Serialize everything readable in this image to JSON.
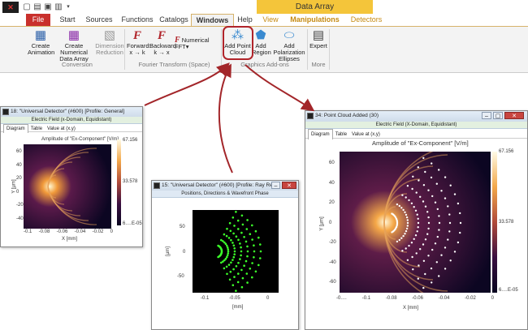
{
  "app": {
    "title": "Data Array"
  },
  "qat": [
    "new-icon",
    "open-icon",
    "save-icon",
    "print-icon",
    "dropdown-icon"
  ],
  "tabs": {
    "file": "File",
    "start": "Start",
    "sources": "Sources",
    "functions": "Functions",
    "catalogs": "Catalogs",
    "windows": "Windows",
    "help": "Help",
    "view": "View",
    "manipulations": "Manipulations",
    "detectors": "Detectors"
  },
  "ribbon": {
    "create_animation": "Create\nAnimation",
    "create_numerical": "Create Numerical\nData Array",
    "dimension_reduction": "Dimension\nReduction",
    "group_conversion": "Conversion",
    "forward": "Forward:\nx → k",
    "backward": "Backward:\nk → x",
    "numerical_fft": "Numerical FFT",
    "group_fourier": "Fourier Transform (Space)",
    "add_point_cloud": "Add Point\nCloud",
    "add_region": "Add\nRegion",
    "add_polarization": "Add Polarization\nEllipses",
    "group_graphics": "Graphics Add-ons",
    "expert": "Expert",
    "group_more": "More"
  },
  "win_left": {
    "title": "18: \"Universal Detector\" (#600) [Profile: General]",
    "subtitle": "Electric Field (x-Domain, Equidistant)",
    "tabs": [
      "Diagram",
      "Table",
      "Value at (x,y)"
    ],
    "plot_title": "Amplitude of \"Ex-Component\" [V/m]",
    "xticks": [
      "-0.1",
      "-0.08",
      "-0.06",
      "-0.04",
      "-0.02",
      "0"
    ],
    "yticks": [
      "60",
      "40",
      "20",
      "0",
      "-20",
      "-40",
      "-60"
    ],
    "xlabel": "X [mm]",
    "ylabel": "Y [µm]",
    "cbar": [
      "67.156",
      "33.578",
      "6.…E-05"
    ]
  },
  "win_mid": {
    "title": "15: \"Universal Detector\" (#600) [Profile: Ray Re…",
    "subtitle": "Positions, Directions & Wavefront Phase",
    "yticks": [
      "50",
      "0",
      "-50"
    ],
    "xticks": [
      "-0.1",
      "-0.05",
      "0"
    ],
    "xlabel": "[mm]",
    "ylabel": "[µm]"
  },
  "win_right": {
    "title": "34: Point Cloud Added (30)",
    "subtitle": "Electric Field (X-Domain, Equidistant)",
    "tabs": [
      "Diagram",
      "Table",
      "Value at (x,y)"
    ],
    "plot_title": "Amplitude of \"Ex-Component\"  [V/m]",
    "xticks": [
      "-0.…",
      "-0.1",
      "-0.08",
      "-0.06",
      "-0.04",
      "-0.02",
      "0"
    ],
    "yticks": [
      "60",
      "40",
      "20",
      "0",
      "-20",
      "-40",
      "-60"
    ],
    "xlabel": "X [mm]",
    "ylabel": "Y [µm]",
    "cbar": [
      "67.156",
      "33.578",
      "6.…E-05"
    ]
  },
  "colors": {
    "accent": "#b0242a",
    "context": "#f4c53a",
    "file": "#c9302c"
  }
}
